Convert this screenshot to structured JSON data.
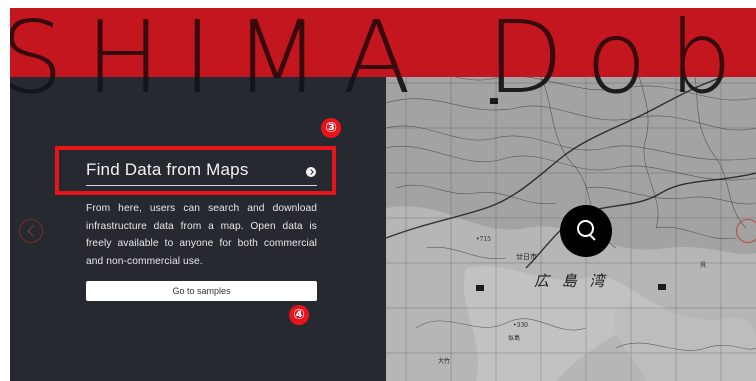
{
  "banner": {
    "text": "SHIMA Dobo",
    "color": "#c4161f"
  },
  "panel": {
    "title": "Find Data from Maps",
    "description": "From here, users can search and download infrastructure data from a map. Open data is freely available to anyone for both commercial and non-commercial use.",
    "samples_button_label": "Go to samples"
  },
  "markers": {
    "step3": "③",
    "step4": "④"
  },
  "map": {
    "bay_label": "広 島 湾",
    "city_label": "廿日市",
    "labels": [
      "•715",
      "•330",
      "似島",
      "大竹",
      "呉"
    ]
  },
  "icons": {
    "search": "search-icon",
    "prev": "chevron-left-icon",
    "next": "chevron-right-icon",
    "arrow": "arrow-right-icon"
  },
  "colors": {
    "highlight": "#e8141b",
    "panel_bg": "#262a30",
    "banner": "#c4161f"
  }
}
